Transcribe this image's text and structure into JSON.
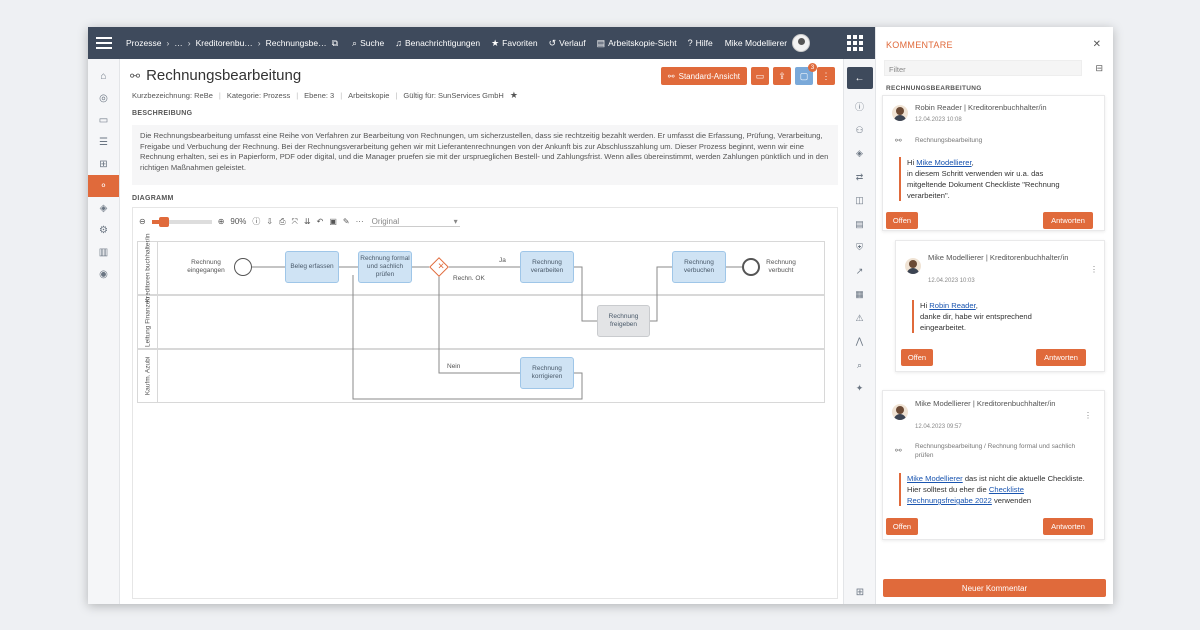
{
  "topbar": {
    "breadcrumbs": [
      "Prozesse",
      "…",
      "Kreditorenbu…",
      "Rechnungsbe…"
    ],
    "nav": [
      {
        "icon": "search-icon",
        "label": "Suche"
      },
      {
        "icon": "bell-icon",
        "label": "Benachrichtigungen"
      },
      {
        "icon": "star-icon",
        "label": "Favoriten"
      },
      {
        "icon": "history-icon",
        "label": "Verlauf"
      },
      {
        "icon": "document-icon",
        "label": "Arbeitskopie-Sicht"
      },
      {
        "icon": "help-icon",
        "label": "Hilfe"
      }
    ],
    "user": "Mike Modellierer"
  },
  "page": {
    "title": "Rechnungsbearbeitung",
    "meta": [
      "Kurzbezeichnung: ReBe",
      "Kategorie: Prozess",
      "Ebene: 3",
      "Arbeitskopie",
      "Gültig für: SunServices GmbH"
    ],
    "standard_view": "Standard-Ansicht",
    "comment_badge": "3",
    "description_label": "BESCHREIBUNG",
    "description": "Die Rechnungsbearbeitung umfasst eine Reihe von Verfahren zur Bearbeitung von Rechnungen, um sicherzustellen, dass sie rechtzeitig bezahlt werden. Er umfasst die Erfassung, Prüfung, Verarbeitung, Freigabe und Verbuchung der Rechnung. Bei der Rechnungsverarbeitung gehen wir mit Lieferantenrechnungen von der Ankunft bis zur Abschlusszahlung um. Dieser Prozess beginnt, wenn wir eine Rechnung erhalten, sei es in Papierform, PDF oder digital, und die Manager pruefen sie mit der ursprueglichen Bestell- und Zahlungsfrist. Wenn alles übereinstimmt, werden Zahlungen pünktlich und in den richtigen Maßnahmen geleistet.",
    "diagram_label": "DIAGRAMM"
  },
  "diagram": {
    "zoom": "90%",
    "zoom_fraction": 0.2,
    "view_select": "Original",
    "lanes": [
      "Kreditoren buchhalter/in",
      "Leitung Finanzen",
      "Kaufm. Azubi"
    ],
    "start_event": "Rechnung eingegangen",
    "end_event": "Rechnung verbucht",
    "tasks": {
      "beleg": "Beleg erfassen",
      "pruefen": "Rechnung formal und sachlich prüfen",
      "verarbeiten": "Rechnung verarbeiten",
      "verbuchen": "Rechnung verbuchen",
      "freigeben": "Rechnung freigeben",
      "korrigieren": "Rechnung korrigieren"
    },
    "gateway": "Rechn. OK",
    "flow_yes": "Ja",
    "flow_no": "Nein"
  },
  "comments": {
    "title": "KOMMENTARE",
    "filter_placeholder": "Filter",
    "subtitle": "RECHNUNGSBEARBEITUNG",
    "open_label": "Offen",
    "reply_label": "Antworten",
    "new_comment": "Neuer Kommentar",
    "items": [
      {
        "author": "Robin Reader | Kreditorenbuchhalter/in",
        "date": "12.04.2023 10:08",
        "ref": "Rechnungsbearbeitung",
        "greeting": "Hi",
        "mention": "Mike Modellierer",
        "text1": ",",
        "text2": "in diesem Schritt verwenden wir u.a. das mitgeltende Dokument Checkliste \"Rechnung verarbeiten\"."
      },
      {
        "author": "Mike Modellierer | Kreditorenbuchhalter/in",
        "date": "12.04.2023 10:03",
        "greeting": "Hi",
        "mention": "Robin Reader",
        "text1": ",",
        "text2": "danke dir, habe wir entsprechend eingearbeitet."
      },
      {
        "author": "Mike Modellierer | Kreditorenbuchhalter/in",
        "date": "12.04.2023 09:57",
        "ref": "Rechnungsbearbeitung / Rechnung formal und sachlich prüfen",
        "mention": "Mike Modellierer",
        "text1": " das ist nicht die aktuelle Checkliste. Hier solltest du eher die ",
        "link": "Checkliste Rechnungsfreigabe 2022",
        "text2": " verwenden"
      }
    ]
  },
  "colors": {
    "accent": "#e06a3b",
    "topbar": "#3e4a5c",
    "task_fill": "#cfe3f4"
  }
}
